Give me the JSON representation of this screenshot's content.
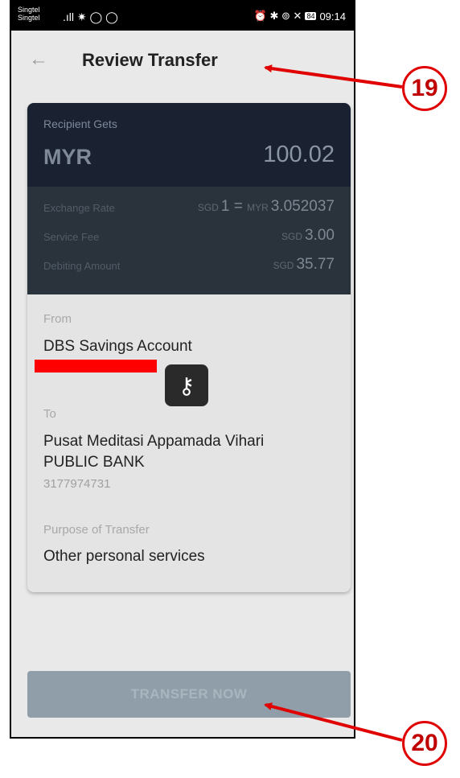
{
  "status_bar": {
    "carrier_top": "Singtel",
    "carrier_bottom": "Singtel",
    "left_icons": ".ıll ✷ ◯ ◯",
    "right_icons": "⏰ ✱ ⊚ ✕",
    "battery": "84",
    "time": "09:14"
  },
  "app_bar": {
    "back_icon": "arrow-left-icon",
    "title": "Review Transfer"
  },
  "summary": {
    "recipient_gets_label": "Recipient Gets",
    "currency": "MYR",
    "amount": "100.02",
    "exchange_rate_label": "Exchange Rate",
    "exchange_rate_from_cur": "SGD",
    "exchange_rate_from_val": "1",
    "exchange_rate_eq": "=",
    "exchange_rate_to_cur": "MYR",
    "exchange_rate_to_val": "3.052037",
    "service_fee_label": "Service Fee",
    "service_fee_cur": "SGD",
    "service_fee_val": "3.00",
    "debiting_amount_label": "Debiting Amount",
    "debiting_amount_cur": "SGD",
    "debiting_amount_val": "35.77"
  },
  "from": {
    "label": "From",
    "account": "DBS Savings Account"
  },
  "to": {
    "label": "To",
    "name": "Pusat Meditasi Appamada Vihari",
    "bank": "PUBLIC BANK",
    "account_number": "3177974731"
  },
  "purpose": {
    "label": "Purpose of Transfer",
    "value": "Other personal services"
  },
  "transfer_button": {
    "label": "TRANSFER NOW"
  },
  "callouts": {
    "top": "19",
    "bottom": "20"
  },
  "colors": {
    "annotation_red": "#e00000",
    "card_header": "#1a2232",
    "button_disabled": "#8f9ea9"
  }
}
